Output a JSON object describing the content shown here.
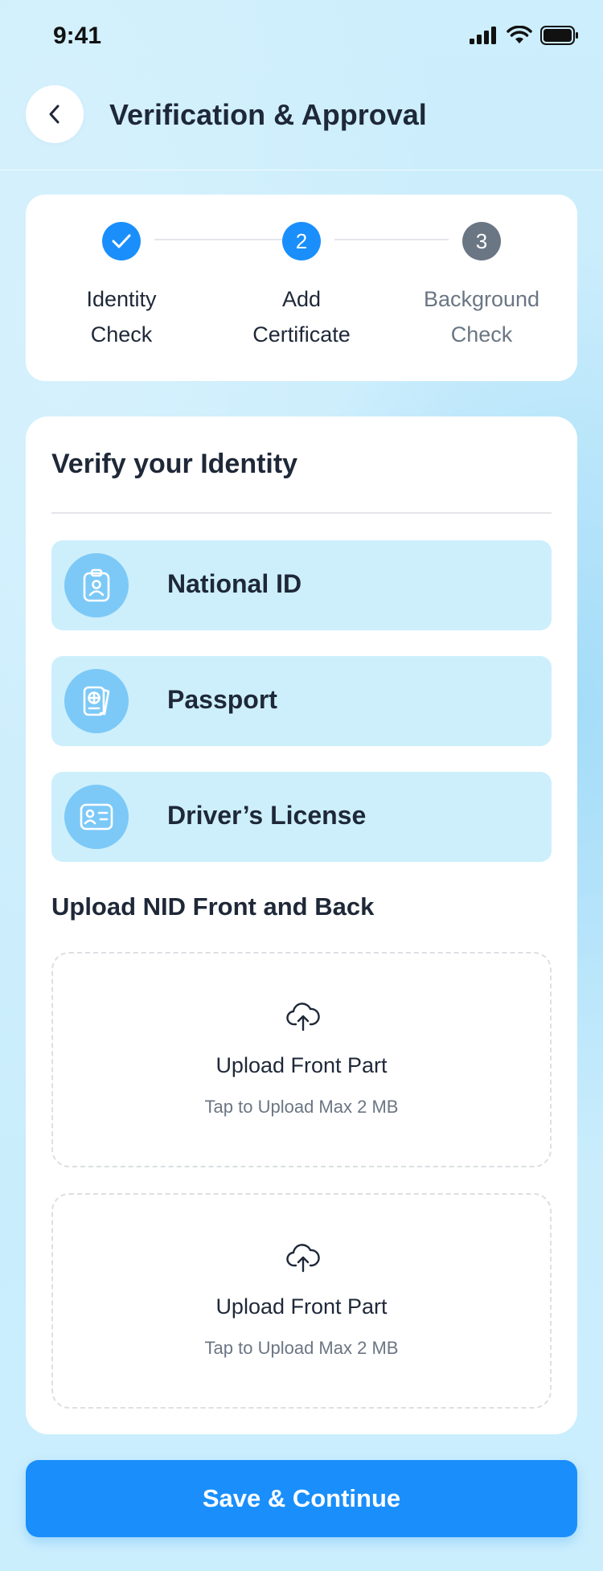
{
  "status_bar": {
    "time": "9:41"
  },
  "header": {
    "title": "Verification & Approval",
    "back_icon": "chevron-left-icon"
  },
  "stepper": {
    "steps": [
      {
        "number": "",
        "line1": "Identity",
        "line2": "Check",
        "state": "completed",
        "color": "#1a8ffb"
      },
      {
        "number": "2",
        "line1": "Add",
        "line2": "Certificate",
        "state": "active",
        "color": "#1a8ffb"
      },
      {
        "number": "3",
        "line1": "Background",
        "line2": "Check",
        "state": "pending",
        "color": "#6b7684"
      }
    ]
  },
  "identity": {
    "title": "Verify your Identity",
    "options": [
      {
        "label": "National ID",
        "icon": "id-badge-icon"
      },
      {
        "label": "Passport",
        "icon": "passport-icon"
      },
      {
        "label": "Driver’s License",
        "icon": "license-card-icon"
      }
    ]
  },
  "upload": {
    "title": "Upload NID Front and Back",
    "boxes": [
      {
        "label": "Upload Front Part",
        "hint": "Tap to Upload Max 2 MB",
        "icon": "cloud-upload-icon"
      },
      {
        "label": "Upload Front Part",
        "hint": "Tap to Upload Max 2 MB",
        "icon": "cloud-upload-icon"
      }
    ]
  },
  "footer": {
    "save_label": "Save & Continue"
  },
  "colors": {
    "primary": "#1a8ffb",
    "option_bg": "#cdeffc",
    "icon_bg": "#7cc9f7",
    "muted": "#6b7684"
  }
}
